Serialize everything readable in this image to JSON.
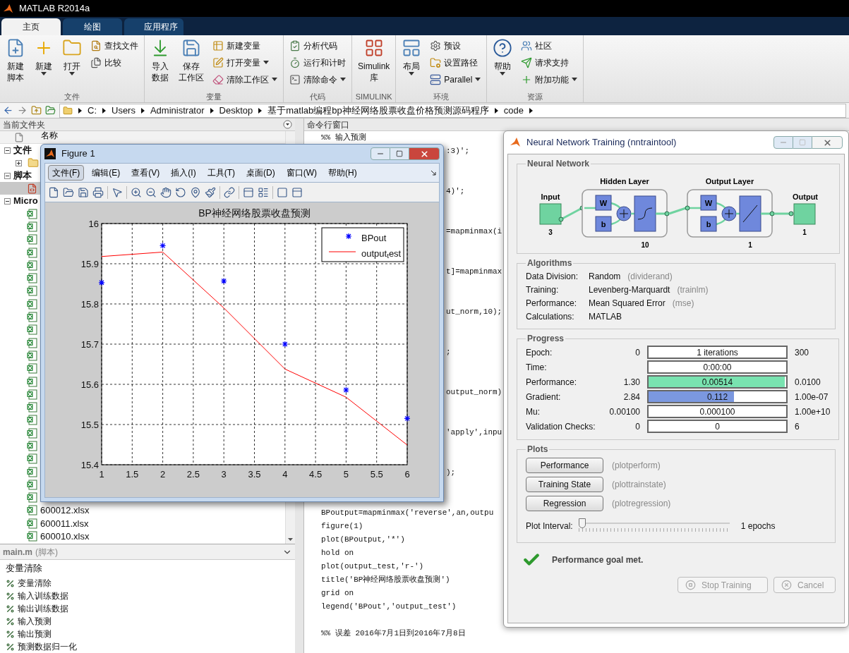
{
  "app": {
    "title": "MATLAB R2014a"
  },
  "ribbon_tabs": [
    {
      "label": "主页",
      "selected": true
    },
    {
      "label": "绘图",
      "selected": false
    },
    {
      "label": "应用程序",
      "selected": false
    }
  ],
  "ribbon_groups": [
    {
      "label": "文件",
      "items": [
        {
          "kind": "large",
          "lines": [
            "新建",
            "脚本"
          ],
          "dropdown": false
        },
        {
          "kind": "large",
          "lines": [
            "新建"
          ],
          "dropdown": true
        },
        {
          "kind": "large",
          "lines": [
            "打开"
          ],
          "dropdown": true
        },
        {
          "kind": "stack",
          "entries": [
            {
              "label": "查找文件",
              "dropdown": false
            },
            {
              "label": "比较",
              "dropdown": false
            }
          ]
        }
      ]
    },
    {
      "label": "变量",
      "items": [
        {
          "kind": "large",
          "lines": [
            "导入",
            "数据"
          ],
          "dropdown": false
        },
        {
          "kind": "large",
          "lines": [
            "保存",
            "工作区"
          ],
          "dropdown": false
        },
        {
          "kind": "stack",
          "entries": [
            {
              "label": "新建变量",
              "dropdown": false
            },
            {
              "label": "打开变量",
              "dropdown": true
            },
            {
              "label": "清除工作区",
              "dropdown": true
            }
          ]
        }
      ]
    },
    {
      "label": "代码",
      "items": [
        {
          "kind": "stack",
          "entries": [
            {
              "label": "分析代码",
              "dropdown": false
            },
            {
              "label": "运行和计时",
              "dropdown": false
            },
            {
              "label": "清除命令",
              "dropdown": true
            }
          ]
        }
      ]
    },
    {
      "label": "SIMULINK",
      "items": [
        {
          "kind": "large",
          "lines": [
            "Simulink",
            "库"
          ],
          "dropdown": false
        }
      ]
    },
    {
      "label": "环境",
      "items": [
        {
          "kind": "large",
          "lines": [
            "布局"
          ],
          "dropdown": true
        },
        {
          "kind": "stack",
          "entries": [
            {
              "label": "预设",
              "dropdown": false
            },
            {
              "label": "设置路径",
              "dropdown": false
            },
            {
              "label": "Parallel",
              "dropdown": true
            }
          ]
        }
      ]
    },
    {
      "label": "资源",
      "items": [
        {
          "kind": "large",
          "lines": [
            "帮助"
          ],
          "dropdown": true
        },
        {
          "kind": "stack",
          "entries": [
            {
              "label": "社区",
              "dropdown": false
            },
            {
              "label": "请求支持",
              "dropdown": false
            },
            {
              "label": "附加功能",
              "dropdown": true
            }
          ]
        }
      ]
    }
  ],
  "address_bar": {
    "segments": [
      "C:",
      "Users",
      "Administrator",
      "Desktop",
      "基于matlab编程bp神经网络股票收盘价格预测源码程序",
      "code"
    ]
  },
  "current_folder": {
    "title": "当前文件夹",
    "column": "名称",
    "tree": [
      {
        "label": "文件",
        "expanded": true,
        "children": [
          {
            "kind": "folder",
            "expanded": false
          }
        ]
      },
      {
        "label": "脚本",
        "expanded": true,
        "children": [
          {
            "kind": "script",
            "selected": true
          }
        ]
      },
      {
        "label": "Micro",
        "expanded": true,
        "children": [
          {
            "kind": "xlsx"
          },
          {
            "kind": "xlsx"
          },
          {
            "kind": "xlsx"
          },
          {
            "kind": "xlsx"
          },
          {
            "kind": "xlsx"
          },
          {
            "kind": "xlsx"
          },
          {
            "kind": "xlsx"
          },
          {
            "kind": "xlsx"
          },
          {
            "kind": "xlsx"
          },
          {
            "kind": "xlsx"
          },
          {
            "kind": "xlsx"
          },
          {
            "kind": "xlsx"
          },
          {
            "kind": "xlsx"
          },
          {
            "kind": "xlsx"
          },
          {
            "kind": "xlsx"
          },
          {
            "kind": "xlsx"
          },
          {
            "kind": "xlsx"
          },
          {
            "kind": "xlsx"
          },
          {
            "kind": "xlsx"
          },
          {
            "kind": "xlsx"
          },
          {
            "kind": "xlsx"
          },
          {
            "kind": "xlsx"
          },
          {
            "kind": "xlsx"
          },
          {
            "kind": "xlsx",
            "label": "600012.xlsx"
          },
          {
            "kind": "xlsx",
            "label": "600011.xlsx"
          },
          {
            "kind": "xlsx",
            "label": "600010.xlsx"
          }
        ]
      }
    ]
  },
  "details": {
    "file": "main.m",
    "type": "(脚本)",
    "heading": "变量清除",
    "cells": [
      "变量清除",
      "输入训练数据",
      "输出训练数据",
      "输入预测",
      "输出预测",
      "预测数据归一化"
    ]
  },
  "command_window": {
    "title": "命令行窗口",
    "lines": [
      {
        "kind": "full",
        "text": "%% 输入预测"
      },
      {
        "kind": "fragment",
        "text": ":3)';"
      },
      {
        "kind": "fragment",
        "text": "4)';"
      },
      {
        "kind": "fragment",
        "text": "=mapminmax(i"
      },
      {
        "kind": "fragment",
        "text": "t]=mapminmax"
      },
      {
        "kind": "fragment",
        "text": "ut_norm,10);"
      },
      {
        "kind": "fragment",
        "text": ";"
      },
      {
        "kind": "fragment",
        "text": "output_norm)"
      },
      {
        "kind": "fragment",
        "text": "'apply',inpu"
      },
      {
        "kind": "fragment",
        "text": ");"
      },
      {
        "kind": "full",
        "text": "BPoutput=mapminmax('reverse',an,outpu"
      },
      {
        "kind": "full",
        "text": "figure(1)"
      },
      {
        "kind": "full",
        "text": "plot(BPoutput,'*')"
      },
      {
        "kind": "full",
        "text": "hold on"
      },
      {
        "kind": "full",
        "text": "plot(output_test,'r-')"
      },
      {
        "kind": "full",
        "text": "title('BP神经网络股票收盘预测')"
      },
      {
        "kind": "full",
        "text": "grid on"
      },
      {
        "kind": "full",
        "text": "legend('BPout','output_test')"
      },
      {
        "kind": "section",
        "text": "%% 误差 2016年7月1日到2016年7月8日"
      }
    ]
  },
  "figure": {
    "title": "Figure 1",
    "menus": [
      {
        "label": "文件(F)",
        "selected": true
      },
      {
        "label": "编辑(E)",
        "selected": false
      },
      {
        "label": "查看(V)",
        "selected": false
      },
      {
        "label": "插入(I)",
        "selected": false
      },
      {
        "label": "工具(T)",
        "selected": false
      },
      {
        "label": "桌面(D)",
        "selected": false
      },
      {
        "label": "窗口(W)",
        "selected": false
      },
      {
        "label": "帮助(H)",
        "selected": false
      }
    ],
    "chart_data": {
      "type": "line",
      "title": "BP神经网络股票收盘预测",
      "x": [
        1,
        2,
        3,
        4,
        5,
        6
      ],
      "series": [
        {
          "name": "BPout",
          "color": "#0000ff",
          "type": "scatter",
          "marker": "cross",
          "values": [
            15.853,
            15.945,
            15.857,
            15.7,
            15.586,
            15.515
          ]
        },
        {
          "name": "output$_{t}$est",
          "color": "#ff0000",
          "type": "line",
          "values": [
            15.918,
            15.929,
            15.79,
            15.638,
            15.568,
            15.449
          ]
        }
      ],
      "grid": true,
      "legend": "upper right",
      "xlim": [
        1,
        6
      ],
      "ylim": [
        15.4,
        16
      ],
      "xticks": [
        1,
        1.5,
        2,
        2.5,
        3,
        3.5,
        4,
        4.5,
        5,
        5.5,
        6
      ],
      "yticks": [
        15.4,
        15.5,
        15.6,
        15.7,
        15.8,
        15.9,
        16
      ]
    }
  },
  "training": {
    "title": "Neural Network Training (nntraintool)",
    "network": {
      "section": "Neural Network",
      "input": {
        "label": "Input",
        "size": "3"
      },
      "layers": [
        {
          "label": "Hidden Layer",
          "size": "10",
          "weight": "W",
          "bias": "b",
          "kind": "sigmoid"
        },
        {
          "label": "Output Layer",
          "size": "1",
          "weight": "W",
          "bias": "b",
          "kind": "linear"
        }
      ],
      "output": {
        "label": "Output",
        "size": "1"
      }
    },
    "algorithms": {
      "section": "Algorithms",
      "rows": [
        {
          "label": "Data Division:",
          "value": "Random",
          "fn": "(dividerand)"
        },
        {
          "label": "Training:",
          "value": "Levenberg-Marquardt",
          "fn": "(trainlm)"
        },
        {
          "label": "Performance:",
          "value": "Mean Squared Error",
          "fn": "(mse)"
        },
        {
          "label": "Calculations:",
          "value": "MATLAB"
        }
      ]
    },
    "progress": {
      "section": "Progress",
      "rows": [
        {
          "label": "Epoch:",
          "start": "0",
          "value": "1 iterations",
          "end": "300",
          "level": 0
        },
        {
          "label": "Time:",
          "value": "0:00:00",
          "level": 0
        },
        {
          "label": "Performance:",
          "start": "1.30",
          "value": "0.00514",
          "end": "0.0100",
          "level": 0.99,
          "color": "#79e3b0"
        },
        {
          "label": "Gradient:",
          "start": "2.84",
          "value": "0.112",
          "end": "1.00e-07",
          "level": 0.62,
          "color": "#7b98e0"
        },
        {
          "label": "Mu:",
          "start": "0.00100",
          "value": "0.000100",
          "end": "1.00e+10",
          "level": 0
        },
        {
          "label": "Validation Checks:",
          "start": "0",
          "value": "0",
          "end": "6",
          "level": 0
        }
      ]
    },
    "plots": {
      "section": "Plots",
      "buttons": [
        {
          "label": "Performance",
          "fn": "(plotperform)"
        },
        {
          "label": "Training State",
          "fn": "(plottrainstate)"
        },
        {
          "label": "Regression",
          "fn": "(plotregression)"
        }
      ],
      "interval_label": "Plot Interval:",
      "interval": {
        "level": 0
      },
      "interval_value": "1 epochs"
    },
    "status": "Performance goal met.",
    "buttons": [
      {
        "label": "Stop Training",
        "disabled": true
      },
      {
        "label": "Cancel",
        "disabled": true
      }
    ]
  }
}
